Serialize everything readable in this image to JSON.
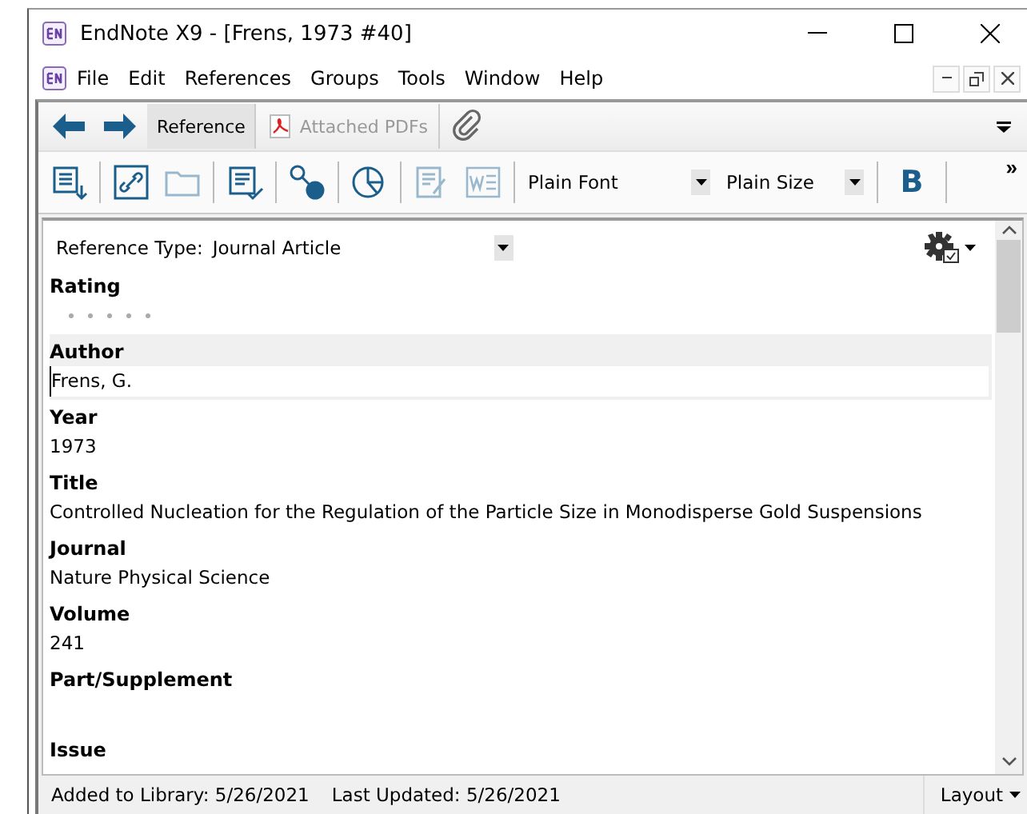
{
  "window": {
    "title": "EndNote X9 - [Frens, 1973 #40]"
  },
  "menu": [
    "File",
    "Edit",
    "References",
    "Groups",
    "Tools",
    "Window",
    "Help"
  ],
  "tabs": [
    {
      "label": "Reference",
      "selected": true,
      "disabled": false
    },
    {
      "label": "Attached PDFs",
      "selected": false,
      "disabled": true
    }
  ],
  "toolbar": {
    "font": "Plain Font",
    "size": "Plain Size",
    "bold": "B",
    "more": "»"
  },
  "reference_type": {
    "label": "Reference Type:",
    "value": "Journal Article"
  },
  "fields": [
    {
      "kind": "rating",
      "label": "Rating",
      "stars": 0,
      "selected": false
    },
    {
      "kind": "text",
      "label": "Author",
      "value": "Frens, G.",
      "selected": true
    },
    {
      "kind": "text",
      "label": "Year",
      "value": "1973",
      "selected": false
    },
    {
      "kind": "text",
      "label": "Title",
      "value": "Controlled Nucleation for the Regulation of the Particle Size in Monodisperse Gold Suspensions",
      "selected": false
    },
    {
      "kind": "text",
      "label": "Journal",
      "value": "Nature Physical Science",
      "selected": false
    },
    {
      "kind": "text",
      "label": "Volume",
      "value": "241",
      "selected": false
    },
    {
      "kind": "text",
      "label": "Part/Supplement",
      "selected": false
    },
    {
      "kind": "text",
      "label": "Issue",
      "selected": false
    }
  ],
  "status_bar": {
    "added": "Added to Library: 5/26/2021",
    "updated": "Last Updated: 5/26/2021",
    "layout": "Layout"
  }
}
